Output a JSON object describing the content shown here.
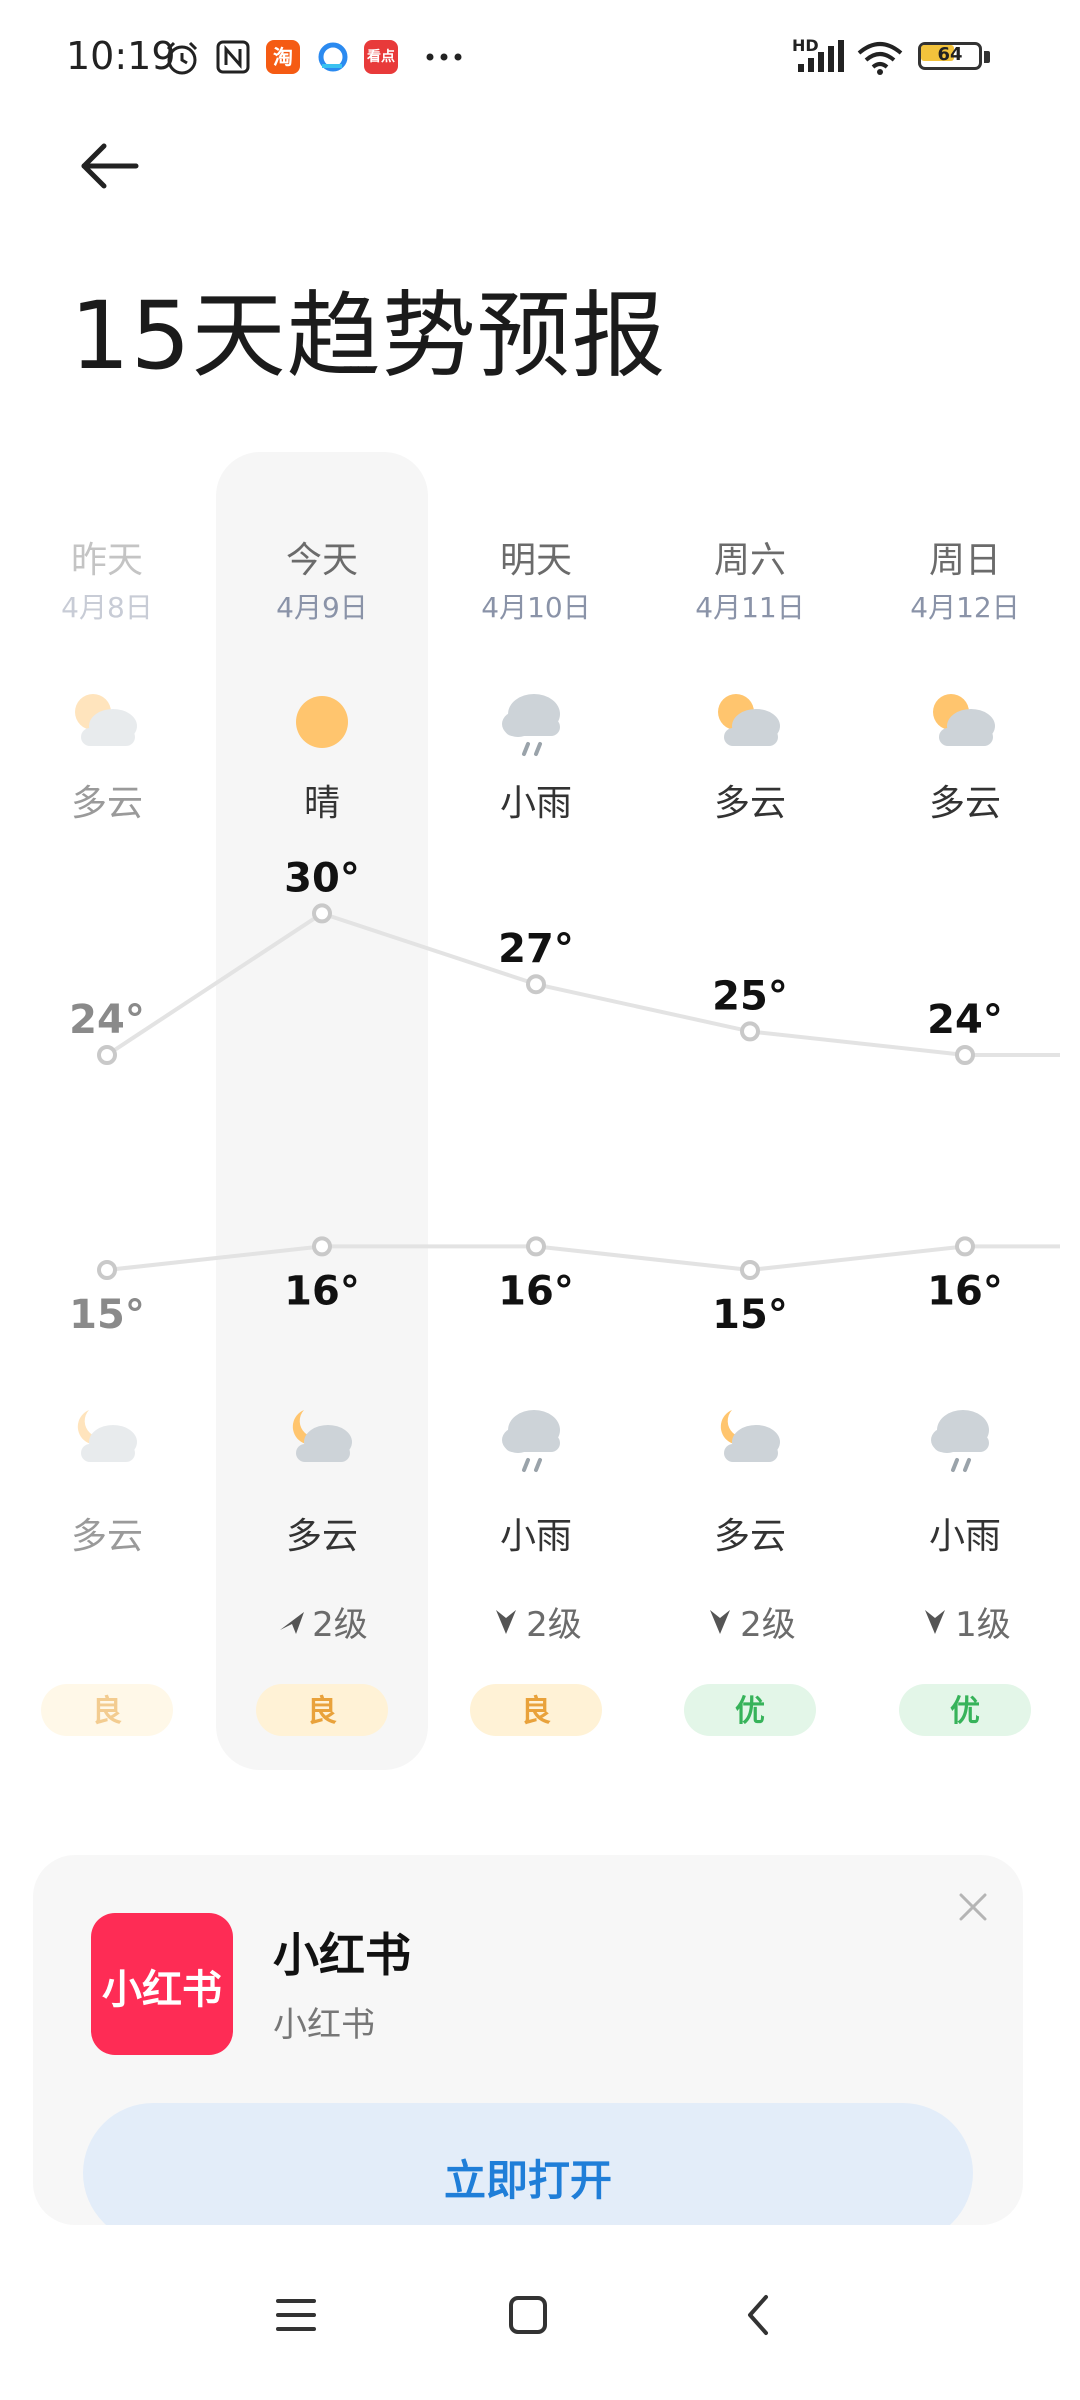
{
  "status_bar": {
    "time": "10:19",
    "icons": [
      "alarm-icon",
      "nfc-icon",
      "taobao-icon",
      "browser-icon",
      "news-icon",
      "more-dots"
    ],
    "signal": "HD",
    "battery": "64",
    "battery_level_percent": 64,
    "colors": {
      "battery_fill": "#f3c33c",
      "taobao": "#f55b13",
      "news": "#e83a3a"
    }
  },
  "header": {
    "title": "15天趋势预报"
  },
  "forecast": {
    "columns": [
      {
        "day": "昨天",
        "date": "4月8日",
        "day_weather": "多云",
        "day_icon": "partly-cloudy-day-icon",
        "high": "24°",
        "low": "15°",
        "night_icon": "partly-cloudy-night-icon",
        "night_weather": "多云",
        "wind": "",
        "aqi": "良",
        "aqi_level": "good",
        "dimmed": true
      },
      {
        "day": "今天",
        "date": "4月9日",
        "day_weather": "晴",
        "day_icon": "sunny-icon",
        "high": "30°",
        "low": "16°",
        "night_icon": "partly-cloudy-night-icon",
        "night_weather": "多云",
        "wind": "2级",
        "wind_dir": "ne",
        "aqi": "良",
        "aqi_level": "good",
        "today": true
      },
      {
        "day": "明天",
        "date": "4月10日",
        "day_weather": "小雨",
        "day_icon": "light-rain-icon",
        "high": "27°",
        "low": "16°",
        "night_icon": "light-rain-icon",
        "night_weather": "小雨",
        "wind": "2级",
        "wind_dir": "s",
        "aqi": "良",
        "aqi_level": "good"
      },
      {
        "day": "周六",
        "date": "4月11日",
        "day_weather": "多云",
        "day_icon": "partly-cloudy-day-icon",
        "high": "25°",
        "low": "15°",
        "night_icon": "partly-cloudy-night-icon",
        "night_weather": "多云",
        "wind": "2级",
        "wind_dir": "s",
        "aqi": "优",
        "aqi_level": "excellent"
      },
      {
        "day": "周日",
        "date": "4月12日",
        "day_weather": "多云",
        "day_icon": "partly-cloudy-day-icon",
        "high": "24°",
        "low": "16°",
        "night_icon": "light-rain-icon",
        "night_weather": "小雨",
        "wind": "1级",
        "wind_dir": "s",
        "aqi": "优",
        "aqi_level": "excellent"
      }
    ],
    "colors": {
      "aqi_good_bg": "#fff2d6",
      "aqi_good_text": "#e9a23b",
      "aqi_excellent_bg": "#e3f6e8",
      "aqi_excellent_text": "#37b35a",
      "line": "#e3e3e3",
      "dot": "#c9c9c9"
    }
  },
  "chart_data": {
    "type": "line",
    "categories": [
      "昨天",
      "今天",
      "明天",
      "周六",
      "周日"
    ],
    "series": [
      {
        "values": [
          24,
          30,
          27,
          25,
          24
        ]
      },
      {
        "values": [
          15,
          16,
          16,
          15,
          16
        ]
      }
    ]
  },
  "promo_card": {
    "logo_text": "小红书",
    "app_name": "小红书",
    "subtitle": "小红书",
    "button_label": "立即打开",
    "colors": {
      "logo": "#fe2c55",
      "button_bg": "#e3edf9",
      "button_text": "#1f7ed8"
    }
  },
  "nav_bar": {
    "buttons": [
      "menu-icon",
      "home-icon",
      "back-icon"
    ]
  }
}
